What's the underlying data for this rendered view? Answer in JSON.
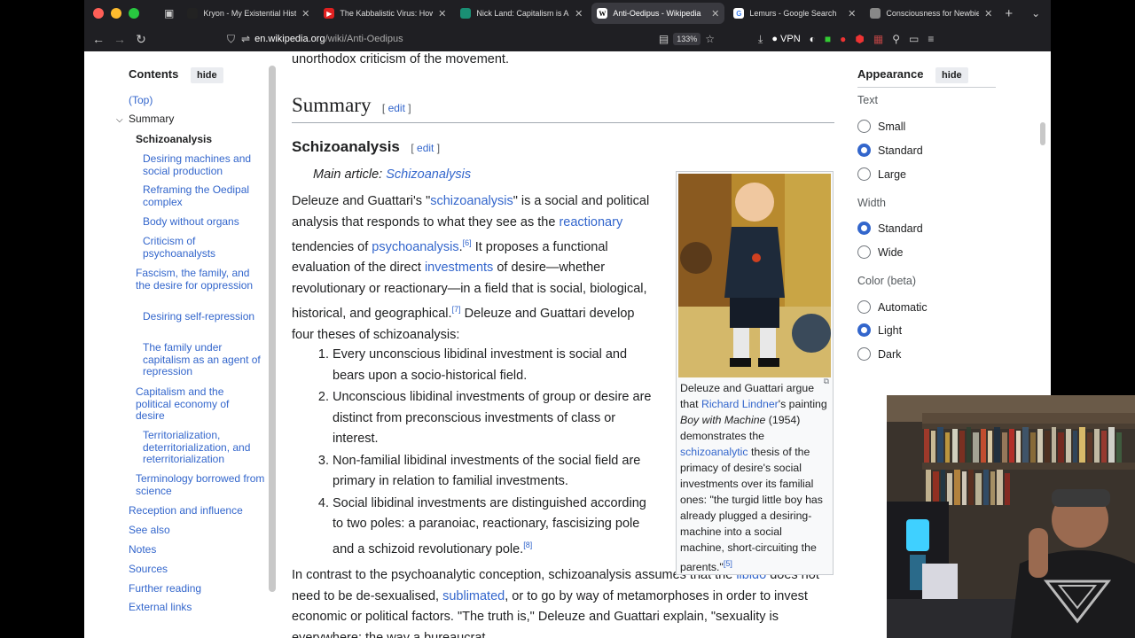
{
  "browser": {
    "tabs": [
      {
        "title": "Kryon - My Existential History",
        "fav_color": "#222222",
        "active": false
      },
      {
        "title": "The Kabbalistic Virus: How Arti",
        "fav_color": "#e02020",
        "active": false
      },
      {
        "title": "Nick Land: Capitalism is AI - A",
        "fav_color": "#1a8f74",
        "active": false
      },
      {
        "title": "Anti-Oedipus - Wikipedia",
        "fav_color": "#ffffff",
        "active": true
      },
      {
        "title": "Lemurs - Google Search",
        "fav_color": "#4285f4",
        "active": false
      },
      {
        "title": "Consciousness for Newbies :: D",
        "fav_color": "#888888",
        "active": false
      }
    ],
    "url_host": "en.wikipedia.org",
    "url_path": "/wiki/Anti-Oedipus",
    "zoom": "133%",
    "vpn_label": "VPN"
  },
  "toc": {
    "title": "Contents",
    "hide": "hide",
    "items": [
      "(Top)",
      "Summary",
      "Schizoanalysis",
      "Desiring machines and social production",
      "Reframing the Oedipal complex",
      "Body without organs",
      "Criticism of psychoanalysts",
      "Fascism, the family, and the desire for oppression",
      "Desiring self-repression",
      "The family under capitalism as an agent of repression",
      "Capitalism and the political economy of desire",
      "Territorialization, deterritorialization, and reterritorialization",
      "Terminology borrowed from science",
      "Reception and influence",
      "See also",
      "Notes",
      "Sources",
      "Further reading",
      "External links"
    ]
  },
  "article": {
    "top_line": "unorthodox criticism of the movement.",
    "h2": "Summary",
    "h3": "Schizoanalysis",
    "edit": "edit",
    "main_article_prefix": "Main article: ",
    "main_article_link": "Schizoanalysis",
    "p1": {
      "a": "Deleuze and Guattari's \"",
      "l1": "schizoanalysis",
      "b": "\" is a social and political analysis that responds to what they see as the ",
      "l2": "reactionary",
      "c": " tendencies of ",
      "l3": "psychoanalysis",
      "d": ".",
      "r1": "[6]",
      "e": " It proposes a functional evaluation of the direct ",
      "l4": "investments",
      "f": " of desire—whether revolutionary or reactionary—in a field that is social, biological, historical, and geographical.",
      "r2": "[7]",
      "g": " Deleuze and Guattari develop four theses of schizoanalysis:"
    },
    "list": [
      "Every unconscious libidinal investment is social and bears upon a socio-historical field.",
      "Unconscious libidinal investments of group or desire are distinct from preconscious investments of class or interest.",
      "Non-familial libidinal investments of the social field are primary in relation to familial investments.",
      "Social libidinal investments are distinguished according to two poles: a paranoiac, reactionary, fascisizing pole and a schizoid revolutionary pole."
    ],
    "list_ref": "[8]",
    "p2": {
      "a": "In contrast to the psychoanalytic conception, schizoanalysis assumes that the ",
      "l1": "libido",
      "b": " does not need to be de-sexualised, ",
      "l2": "sublimated",
      "c": ", or to go by way of metamorphoses in order to invest economic or political factors.",
      "d": "\"The truth is,\" Deleuze and Guattari explain, \"sexuality is everywhere: the way a bureaucrat"
    },
    "caption": {
      "a": "Deleuze and Guattari argue that ",
      "l1": "Richard Lindner",
      "b": "'s painting ",
      "i": "Boy with Machine",
      "c": " (1954) demonstrates the ",
      "l2": "schizoanalytic",
      "d": " thesis of the primacy of desire's social investments over its familial ones: \"the turgid little boy has already plugged a desiring-machine into a social machine, short-circuiting the parents.\"",
      "r": "[5]"
    }
  },
  "appearance": {
    "title": "Appearance",
    "hide": "hide",
    "text_label": "Text",
    "text_options": [
      "Small",
      "Standard",
      "Large"
    ],
    "text_selected": "Standard",
    "width_label": "Width",
    "width_options": [
      "Standard",
      "Wide"
    ],
    "width_selected": "Standard",
    "color_label": "Color (beta)",
    "color_options": [
      "Automatic",
      "Light",
      "Dark"
    ],
    "color_selected": "Light"
  },
  "colors": {
    "link": "#3366cc",
    "accent": "#3366cc",
    "text": "#202122"
  }
}
